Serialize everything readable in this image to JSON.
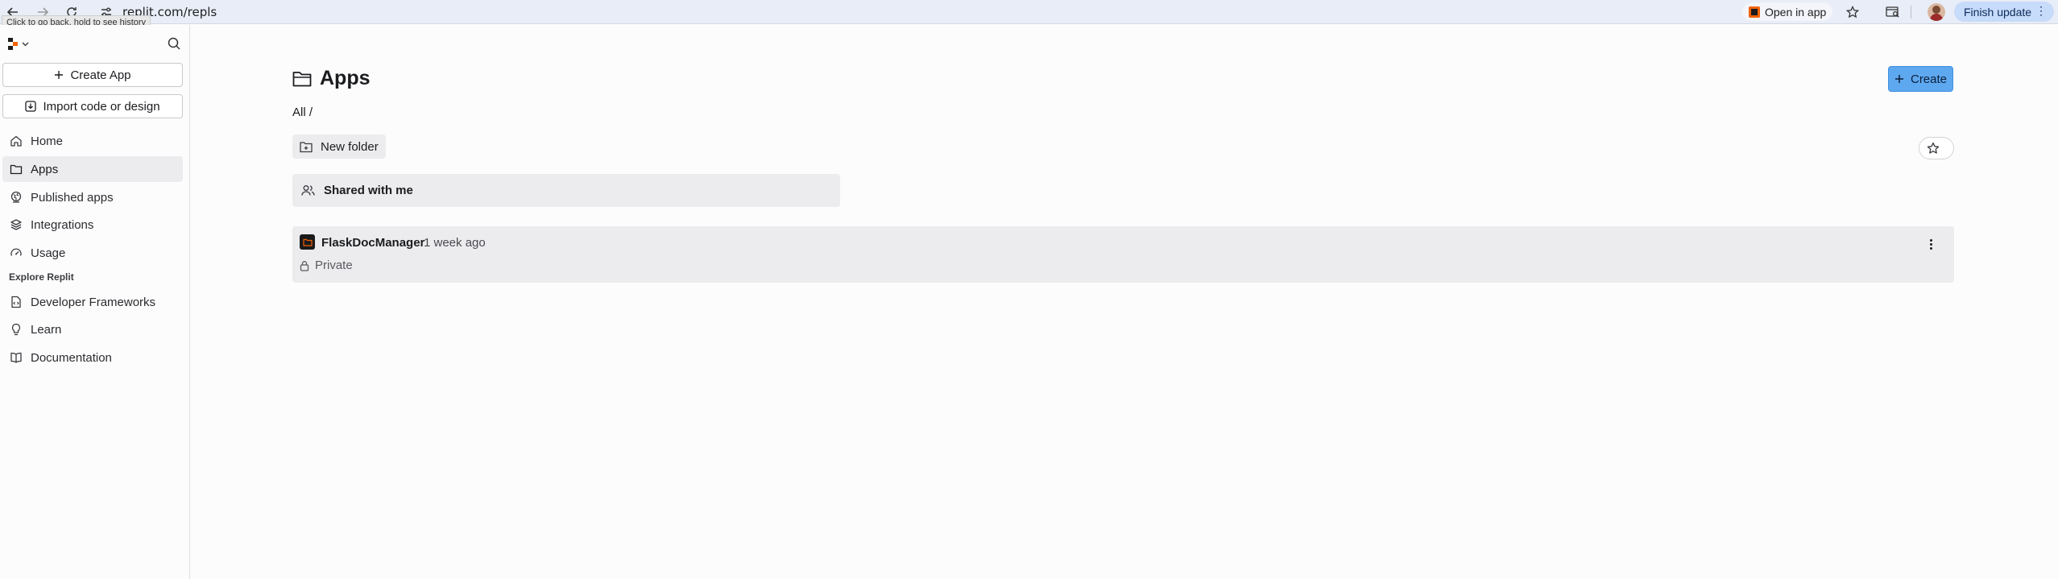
{
  "browser": {
    "url": "replit.com/repls",
    "tooltip": "Click to go back, hold to see history",
    "open_in_app": "Open in app",
    "finish_update": "Finish update"
  },
  "sidebar": {
    "create_app": "Create App",
    "import_code": "Import code or design",
    "nav": [
      {
        "label": "Home",
        "icon": "home-icon"
      },
      {
        "label": "Apps",
        "icon": "folder-icon",
        "active": true
      },
      {
        "label": "Published apps",
        "icon": "globe-icon"
      },
      {
        "label": "Integrations",
        "icon": "layers-icon"
      },
      {
        "label": "Usage",
        "icon": "gauge-icon"
      }
    ],
    "explore_label": "Explore Replit",
    "explore": [
      {
        "label": "Developer Frameworks",
        "icon": "file-code-icon"
      },
      {
        "label": "Learn",
        "icon": "lightbulb-icon"
      },
      {
        "label": "Documentation",
        "icon": "book-icon"
      }
    ]
  },
  "main": {
    "title": "Apps",
    "create_label": "Create",
    "breadcrumb": "All /",
    "new_folder": "New folder",
    "shared_with_me": "Shared with me",
    "repls": [
      {
        "name": "FlaskDocManager",
        "updated": "1 week ago",
        "visibility": "Private"
      }
    ]
  },
  "colors": {
    "accent": "#5ea8f0",
    "brand": "#f26207",
    "update_pill": "#c7dbfa"
  }
}
